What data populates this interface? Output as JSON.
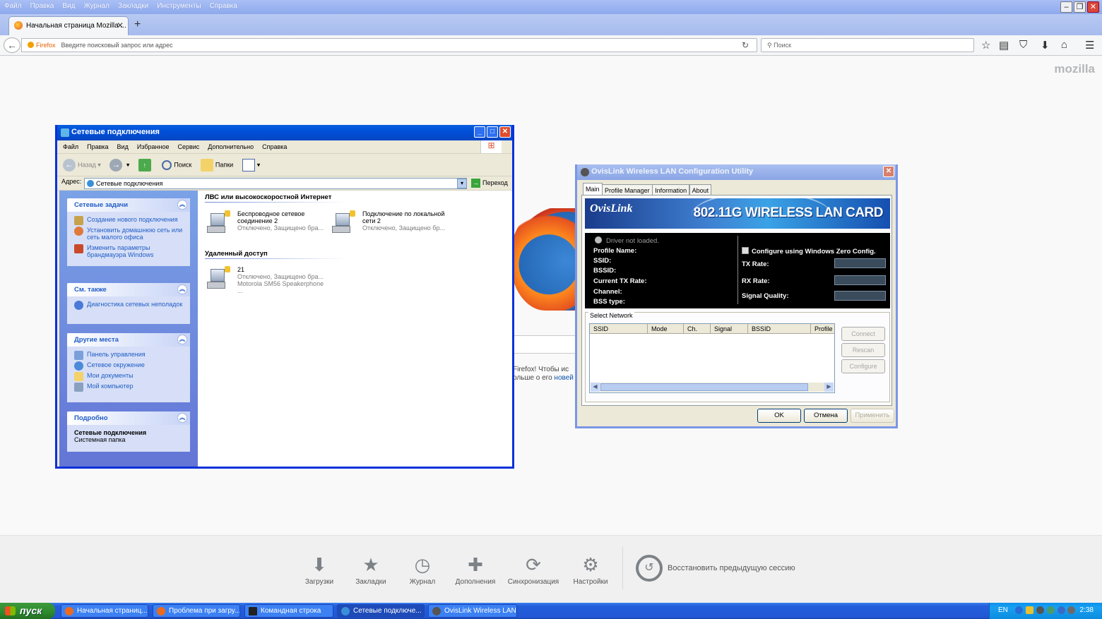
{
  "firefox": {
    "menu": [
      "Файл",
      "Правка",
      "Вид",
      "Журнал",
      "Закладки",
      "Инструменты",
      "Справка"
    ],
    "tab_title": "Начальная страница Mozilla ...",
    "new_tab": "+",
    "url_identity": "Firefox",
    "url_placeholder": "Введите поисковый запрос или адрес",
    "search_placeholder": "Поиск",
    "brand": "mozilla",
    "snippet_line1": "Firefox! Чтобы ис",
    "snippet_line2a": "ольше о его ",
    "snippet_link": "новей",
    "launcher": [
      {
        "label": "Загрузки",
        "icon": "download-icon"
      },
      {
        "label": "Закладки",
        "icon": "bookmark-star-icon"
      },
      {
        "label": "Журнал",
        "icon": "history-clock-icon"
      },
      {
        "label": "Дополнения",
        "icon": "addons-puzzle-icon"
      },
      {
        "label": "Синхронизация",
        "icon": "sync-icon"
      },
      {
        "label": "Настройки",
        "icon": "settings-gear-icon"
      }
    ],
    "restore_session": "Восстановить предыдущую сессию"
  },
  "netwin": {
    "title": "Сетевые подключения",
    "menu": [
      "Файл",
      "Правка",
      "Вид",
      "Избранное",
      "Сервис",
      "Дополнительно",
      "Справка"
    ],
    "toolbar": {
      "back": "Назад",
      "search": "Поиск",
      "folders": "Папки"
    },
    "address_label": "Адрес:",
    "address_value": "Сетевые подключения",
    "go_label": "Переход",
    "panes": {
      "tasks": {
        "title": "Сетевые задачи",
        "items": [
          "Создание нового подключения",
          "Установить домашнюю сеть или сеть малого офиса",
          "Изменить параметры брандмауэра Windows"
        ]
      },
      "see_also": {
        "title": "См. также",
        "items": [
          "Диагностика сетевых неполадок"
        ]
      },
      "places": {
        "title": "Другие места",
        "items": [
          "Панель управления",
          "Сетевое окружение",
          "Мои документы",
          "Мой компьютер"
        ]
      },
      "details": {
        "title": "Подробно",
        "name": "Сетевые подключения",
        "type": "Системная папка"
      }
    },
    "groups": {
      "lan": {
        "title": "ЛВС или высокоскоростной Интернет",
        "items": [
          {
            "name1": "Беспроводное сетевое",
            "name2": "соединение 2",
            "status": "Отключено, Защищено бра..."
          },
          {
            "name1": "Подключение по локальной",
            "name2": "сети 2",
            "status": "Отключено, Защищено бр..."
          }
        ]
      },
      "remote": {
        "title": "Удаленный доступ",
        "items": [
          {
            "name1": "21",
            "status": "Отключено, Защищено бра...",
            "device": "Motorola SM56 Speakerphone ..."
          }
        ]
      }
    }
  },
  "ovis": {
    "title": "OvisLink Wireless LAN Configuration Utility",
    "tabs": [
      "Main",
      "Profile Manager",
      "Information",
      "About"
    ],
    "brand": "OvisLink",
    "product": "802.11G WIRELESS LAN CARD",
    "driver_status": "Driver not loaded.",
    "left_labels": [
      "Profile Name:",
      "SSID:",
      "BSSID:",
      "Current TX Rate:",
      "Channel:",
      "BSS type:"
    ],
    "zero_config": "Configure using Windows Zero Config.",
    "right_labels": [
      "TX Rate:",
      "RX Rate:",
      "Signal Quality:"
    ],
    "select_network": "Select Network",
    "columns": [
      "SSID",
      "Mode",
      "Ch.",
      "Signal",
      "BSSID",
      "Profile"
    ],
    "buttons": {
      "connect": "Connect",
      "rescan": "Rescan",
      "configure": "Configure"
    },
    "footer": {
      "ok": "OK",
      "cancel": "Отмена",
      "apply": "Применить"
    }
  },
  "taskbar": {
    "start": "пуск",
    "buttons": [
      {
        "label": "Начальная страниц...",
        "color": "#ec6a1c"
      },
      {
        "label": "Проблема при загру...",
        "color": "#ec6a1c"
      },
      {
        "label": "Командная строка",
        "color": "#222222"
      },
      {
        "label": "Сетевые подключе...",
        "color": "#3a8fd8"
      },
      {
        "label": "OvisLink Wireless LAN...",
        "color": "#555555"
      }
    ],
    "lang": "EN",
    "clock": "2:38"
  }
}
